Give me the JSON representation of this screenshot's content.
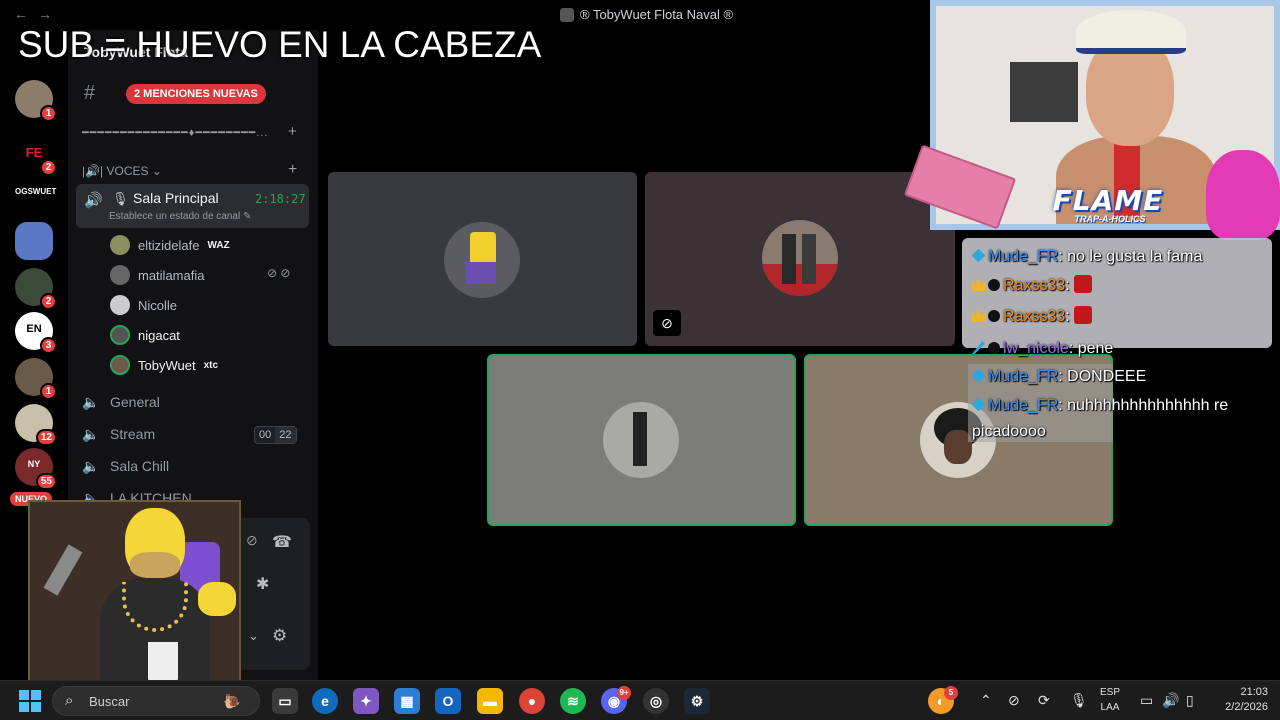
{
  "window": {
    "title": "® TobyWuet Flota Naval ®",
    "back_icon": "arrow-left-icon",
    "forward_icon": "arrow-right-icon"
  },
  "overlay_caption": "SUB = HUEVO EN LA CABEZA",
  "rail": {
    "servers": [
      {
        "label": "",
        "badge": "1"
      },
      {
        "label": "FE",
        "badge": "2"
      },
      {
        "label": "OGSWUET",
        "badge": ""
      },
      {
        "label": "",
        "badge": ""
      },
      {
        "label": "",
        "badge": "2"
      },
      {
        "label": "EN",
        "badge": "3"
      },
      {
        "label": "",
        "badge": "1"
      },
      {
        "label": "",
        "badge": "12"
      },
      {
        "label": "NY",
        "badge": "55"
      }
    ],
    "new_pill": "NUEVO"
  },
  "sidebar": {
    "server_name": "TobyWuet Flota ...",
    "mentions_pill": "2 MENCIONES NUEVAS",
    "divider_channel": "━━━━━━━━━━━━━━♦━━━━━━━━...",
    "category": "VOCES",
    "active_channel": {
      "name": "Sala Principal",
      "time": "2:18:27",
      "status": "Establece un estado de canal"
    },
    "members": [
      {
        "name": "eltizidelafe",
        "tag": "WAZ"
      },
      {
        "name": "matilamafia",
        "tag": ""
      },
      {
        "name": "Nicolle",
        "tag": ""
      },
      {
        "name": "nigacat",
        "tag": ""
      },
      {
        "name": "TobyWuet",
        "tag": "xtc"
      }
    ],
    "channels": [
      {
        "name": "General"
      },
      {
        "name": "Stream"
      },
      {
        "name": "Sala Chill"
      },
      {
        "name": "LA KITCHEN"
      }
    ],
    "stream_counts": [
      "00",
      "22"
    ]
  },
  "stream": {
    "flame_title": "FLAME",
    "flame_subtitle": "TRAP-A-HOLICS"
  },
  "chat": [
    {
      "user": "Mude_FR",
      "text": ": no le gusta la fama",
      "icon": "cube-icon",
      "user_color": "#3c8ff0"
    },
    {
      "user": "Raxss33",
      "text": ":",
      "icon": "crown-icon",
      "user_color": "#f08a1a"
    },
    {
      "user": "Raxss33",
      "text": ":",
      "icon": "crown-icon",
      "user_color": "#f08a1a"
    },
    {
      "user": "lw_nicole",
      "text": ": pene",
      "icon": "sword-icon",
      "user_color": "#9b6cf0"
    },
    {
      "user": "Mude_FR",
      "text": ": DONDEEE",
      "icon": "cube-icon",
      "user_color": "#3c8ff0"
    },
    {
      "user": "Mude_FR",
      "text": ": nuhhhhhhhhhhhhhh re",
      "icon": "cube-icon",
      "user_color": "#3c8ff0"
    }
  ],
  "chat_continuation": "picadoooo",
  "taskbar": {
    "search_placeholder": "Buscar",
    "discord_badge": "9+",
    "notif_badge": "5",
    "lang_line1": "ESP",
    "lang_line2": "LAA",
    "time": "21:03",
    "date": "2/2/2026"
  }
}
